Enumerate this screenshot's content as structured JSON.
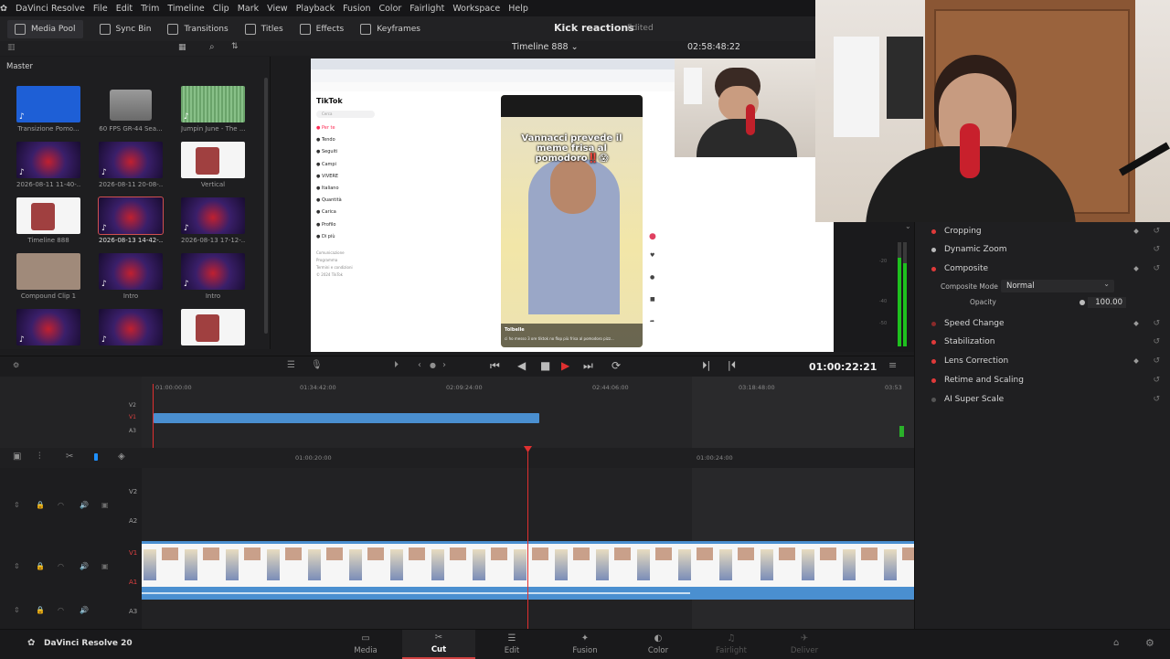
{
  "app": {
    "name": "DaVinci Resolve",
    "version_label": "DaVinci Resolve 20",
    "project": "Kick reactions",
    "status": "Edited"
  },
  "menu": [
    "DaVinci Resolve",
    "File",
    "Edit",
    "Trim",
    "Timeline",
    "Clip",
    "Mark",
    "View",
    "Playback",
    "Fusion",
    "Color",
    "Fairlight",
    "Workspace",
    "Help"
  ],
  "toolbar": {
    "media_pool": "Media Pool",
    "sync_bin": "Sync Bin",
    "transitions": "Transitions",
    "titles": "Titles",
    "effects": "Effects",
    "keyframes": "Keyframes"
  },
  "viewer": {
    "timeline_name": "Timeline 888",
    "timecode": "02:58:48:22"
  },
  "media_pool": {
    "bin": "Master",
    "clips": [
      {
        "name": "Transizione Pomo...",
        "kind": "audio",
        "color": "#1e5fd6"
      },
      {
        "name": "60 FPS GR-44 Sea...",
        "kind": "folder",
        "color": "#8a8a8a"
      },
      {
        "name": "Jumpin June - The ...",
        "kind": "audio",
        "color": "#6aa36a"
      },
      {
        "name": "2026-08-11 11-40-...",
        "kind": "video",
        "color": "#3a1f6a"
      },
      {
        "name": "2026-08-11 20-08-...",
        "kind": "video",
        "color": "#3a1f6a"
      },
      {
        "name": "Vertical",
        "kind": "timeline",
        "color": "#f5f5f5"
      },
      {
        "name": "Timeline 888",
        "kind": "timeline",
        "color": "#f5f5f5"
      },
      {
        "name": "2026-08-13 14-42-...",
        "kind": "video",
        "color": "#3a1f6a",
        "selected": true
      },
      {
        "name": "2026-08-13 17-12-...",
        "kind": "video",
        "color": "#3a1f6a"
      },
      {
        "name": "Compound Clip 1",
        "kind": "compound",
        "color": "#a08a7a"
      },
      {
        "name": "Intro",
        "kind": "video",
        "color": "#8a6a5a"
      },
      {
        "name": "Intro",
        "kind": "video",
        "color": "#a08a7a"
      },
      {
        "name": "",
        "kind": "video",
        "color": "#c8bfb8"
      },
      {
        "name": "",
        "kind": "video",
        "color": "#222"
      },
      {
        "name": "",
        "kind": "timeline",
        "color": "#f5f5f5"
      }
    ]
  },
  "tiktok": {
    "logo": "TikTok",
    "search": "Cerca",
    "nav": [
      "Per te",
      "Tendo",
      "Seguiti",
      "Campi",
      "VIVERE",
      "Italiano",
      "Quantità",
      "Carica",
      "Profilo",
      "Di più"
    ],
    "footer": [
      "Comunicazione",
      "Programma",
      "Termini e condizioni",
      "© 2024 TikTok"
    ],
    "caption": "Vannacci prevede il meme frisa al pomodoro‼️😱",
    "bottom_user": "Tolbelle",
    "bottom_desc": "ci ho messo 3 ore tiktok no flop più frisa al pomodoro pizz..."
  },
  "inspector": {
    "items": [
      {
        "label": "Cropping",
        "dot": "#e03a3a",
        "kf": true
      },
      {
        "label": "Dynamic Zoom",
        "dot": "#bbbbbb",
        "kf": false
      },
      {
        "label": "Composite",
        "dot": "#e03a3a",
        "kf": true
      },
      {
        "label": "Speed Change",
        "dot": "#8a2a2a",
        "kf": true
      },
      {
        "label": "Stabilization",
        "dot": "#e03a3a",
        "kf": false
      },
      {
        "label": "Lens Correction",
        "dot": "#e03a3a",
        "kf": true
      },
      {
        "label": "Retime and Scaling",
        "dot": "#e03a3a",
        "kf": false
      },
      {
        "label": "AI Super Scale",
        "dot": "#555555",
        "kf": false
      }
    ],
    "composite_mode_label": "Composite Mode",
    "composite_mode_value": "Normal",
    "opacity_label": "Opacity",
    "opacity_value": "100.00"
  },
  "transport": {
    "timecode": "01:00:22:21"
  },
  "mini_timeline": {
    "ruler": [
      "01:00:00:00",
      "01:34:42:00",
      "02:09:24:00",
      "02:44:06:00",
      "03:18:48:00",
      "03:53"
    ]
  },
  "lower_timeline": {
    "ruler": [
      "01:00:20:00",
      "01:00:24:00"
    ],
    "tracks": [
      "V2",
      "A2",
      "V1",
      "A1",
      "A3"
    ]
  },
  "mini_tracks": [
    "V2",
    "V1",
    "A3"
  ],
  "pages": [
    {
      "label": "Media",
      "icon": "▭"
    },
    {
      "label": "Cut",
      "icon": "✂",
      "active": true
    },
    {
      "label": "Edit",
      "icon": "☰"
    },
    {
      "label": "Fusion",
      "icon": "✦"
    },
    {
      "label": "Color",
      "icon": "◐"
    },
    {
      "label": "Fairlight",
      "icon": "♫",
      "dim": true
    },
    {
      "label": "Deliver",
      "icon": "✈",
      "dim": true
    }
  ],
  "colors": {
    "accent": "#d04040",
    "playhead": "#e03030",
    "clip_blue": "#4a8fd0"
  }
}
